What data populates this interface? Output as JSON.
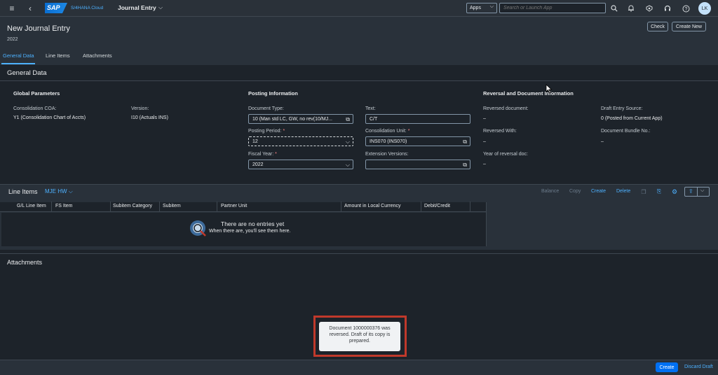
{
  "shell": {
    "menu_icon": "menu-icon",
    "back_icon": "back-icon",
    "logo": "SAP",
    "product": "S/4HANA Cloud",
    "app_title": "Journal Entry",
    "apps_label": "Apps",
    "search_placeholder": "Search or Launch App",
    "avatar": "LK"
  },
  "header": {
    "title": "New Journal Entry",
    "subtitle": "2022",
    "check": "Check",
    "create_new": "Create New"
  },
  "tabs": [
    "General Data",
    "Line Items",
    "Attachments"
  ],
  "general": {
    "section_title": "General Data",
    "global": {
      "title": "Global Parameters",
      "coa_label": "Consolidation COA:",
      "coa_value": "Y1 (Consolidation Chart of Accts)",
      "version_label": "Version:",
      "version_value": "I10 (Actuals INS)"
    },
    "posting": {
      "title": "Posting Information",
      "doctype_label": "Document Type:",
      "doctype_value": "10 (Man std LC, GW, no rev(10/MJ...",
      "period_label": "Posting Period:",
      "period_value": "12",
      "year_label": "Fiscal Year:",
      "year_value": "2022",
      "text_label": "Text:",
      "text_value": "C/T",
      "unit_label": "Consolidation Unit:",
      "unit_value": "INS070 (INS070)",
      "ext_label": "Extension Versions:",
      "ext_value": "",
      "required": "*"
    },
    "reversal": {
      "title": "Reversal and Document Information",
      "reversed_doc_label": "Reversed document:",
      "reversed_doc_value": "–",
      "reversed_with_label": "Reversed With:",
      "reversed_with_value": "–",
      "year_rev_label": "Year of reversal doc:",
      "year_rev_value": "–",
      "draft_source_label": "Draft Entry Source:",
      "draft_source_value": "0 (Posted from Current App)",
      "bundle_label": "Document Bundle No.:",
      "bundle_value": "–"
    }
  },
  "line_items": {
    "title": "Line Items",
    "variant": "MJE HW",
    "toolbar": {
      "balance": "Balance",
      "copy": "Copy",
      "create": "Create",
      "delete": "Delete"
    },
    "columns": [
      "G/L Line Item",
      "FS Item",
      "Subitem Category",
      "Subitem",
      "Partner Unit",
      "Amount in Local Currency",
      "Debit/Credit"
    ],
    "empty_title": "There are no entries yet",
    "empty_sub": "When there are, you'll see them here."
  },
  "attachments": {
    "title": "Attachments"
  },
  "toast": {
    "message": "Document 1000000376 was reversed. Draft of its copy is prepared."
  },
  "footer": {
    "create": "Create",
    "discard": "Discard Draft"
  },
  "colors": {
    "accent": "#4db1ff",
    "shell": "#2a3139",
    "background": "#1d232a",
    "emphasized": "#0070f2",
    "highlight_box": "#c0392b"
  }
}
